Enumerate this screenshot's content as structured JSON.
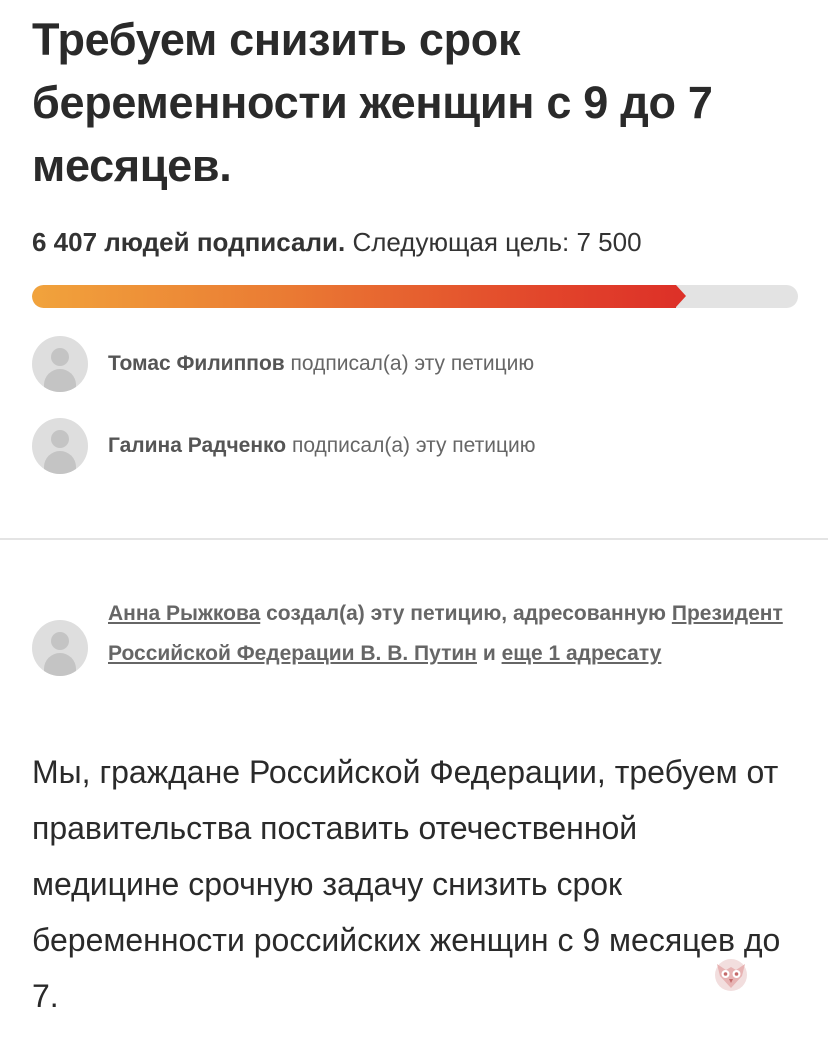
{
  "petition": {
    "title": "Требуем снизить срок беременности женщин с 9 до 7 месяцев."
  },
  "progress": {
    "signed_text": "6 407 людей подписали.",
    "goal_text": "Следующая цель: 7 500",
    "signed": 6407,
    "goal": 7500,
    "fill_fraction": 0.854,
    "colors": {
      "start": "#f1a33c",
      "end": "#dd3128",
      "track": "#e3e3e3"
    }
  },
  "signers": [
    {
      "name": "Томас Филиппов",
      "action": "подписал(а) эту петицию"
    },
    {
      "name": "Галина Радченко",
      "action": "подписал(а) эту петицию"
    }
  ],
  "creator": {
    "name": "Анна Рыжкова",
    "action": "создал(а) эту петицию, адресованную",
    "addressee": "Президент Российской Федерации В. В. Путин",
    "and": "и",
    "more": "еще 1 адресату"
  },
  "body": {
    "text": "Мы, граждане Российской Федерации, требуем от правительства поставить отечественной медицине срочную задачу снизить срок беременности российских женщин с 9 месяцев до 7."
  },
  "icons": {
    "avatar": "default-user-avatar-icon",
    "watermark": "owl-logo-icon"
  }
}
